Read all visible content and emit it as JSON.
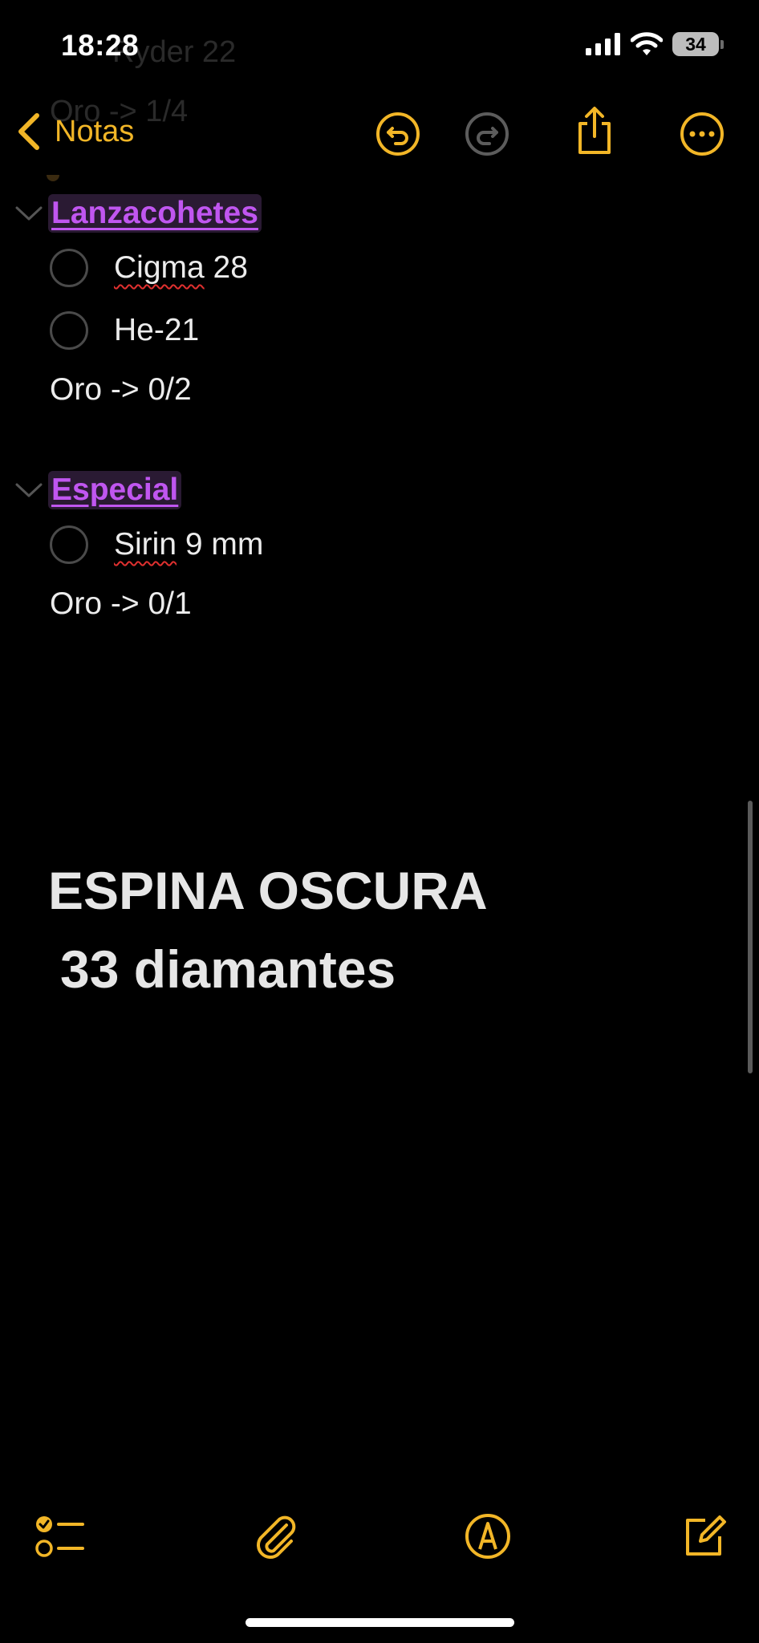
{
  "status_bar": {
    "time": "18:28",
    "battery": "34"
  },
  "ghost_lines": [
    "Ryder 22",
    "Oro -> 1/4"
  ],
  "nav": {
    "back_label": "Notas"
  },
  "note": {
    "sections": [
      {
        "title": "Lanzacohetes",
        "items": [
          {
            "word": "Cigma",
            "rest": " 28",
            "misspelled": true
          },
          {
            "word": "He-21",
            "rest": "",
            "misspelled": false
          }
        ],
        "summary": "Oro -> 0/2"
      },
      {
        "title": "Especial",
        "items": [
          {
            "word": "Sirin",
            "rest": " 9 mm",
            "misspelled": true
          }
        ],
        "summary": "Oro -> 0/1"
      }
    ],
    "heading_line1": "ESPINA OSCURA",
    "heading_line2": "33 diamantes"
  },
  "colors": {
    "accent": "#f2b627",
    "highlight_text": "#c056f0",
    "background": "#000000",
    "text": "#ececec"
  },
  "icons": {
    "nav": [
      "chevron-left-icon",
      "undo-icon",
      "redo-icon",
      "share-icon",
      "more-icon"
    ],
    "toolbar": [
      "checklist-icon",
      "paperclip-icon",
      "markup-pen-icon",
      "compose-icon"
    ]
  }
}
